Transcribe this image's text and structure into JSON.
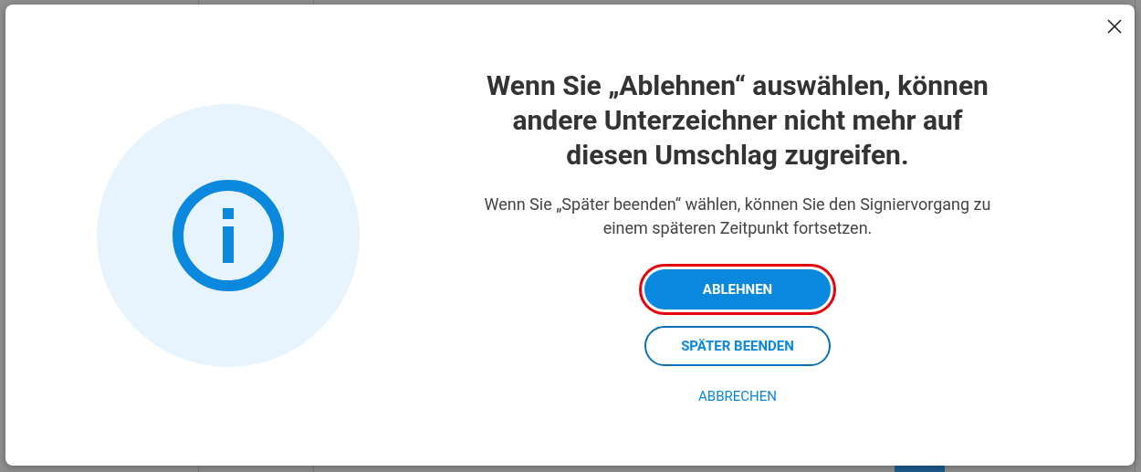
{
  "dialog": {
    "heading": "Wenn Sie „Ablehnen“ auswählen, können andere Unterzeichner nicht mehr auf diesen Umschlag zugreifen.",
    "message": "Wenn Sie „Später beenden“ wählen, können Sie den Signiervorgang zu einem späteren Zeitpunkt fortsetzen.",
    "buttons": [
      {
        "label": "ABLEHNEN",
        "kind": "primary",
        "highlighted": true
      },
      {
        "label": "SPÄTER BEENDEN",
        "kind": "outline",
        "highlighted": false
      },
      {
        "label": "ABBRECHEN",
        "kind": "text",
        "highlighted": false
      }
    ]
  }
}
